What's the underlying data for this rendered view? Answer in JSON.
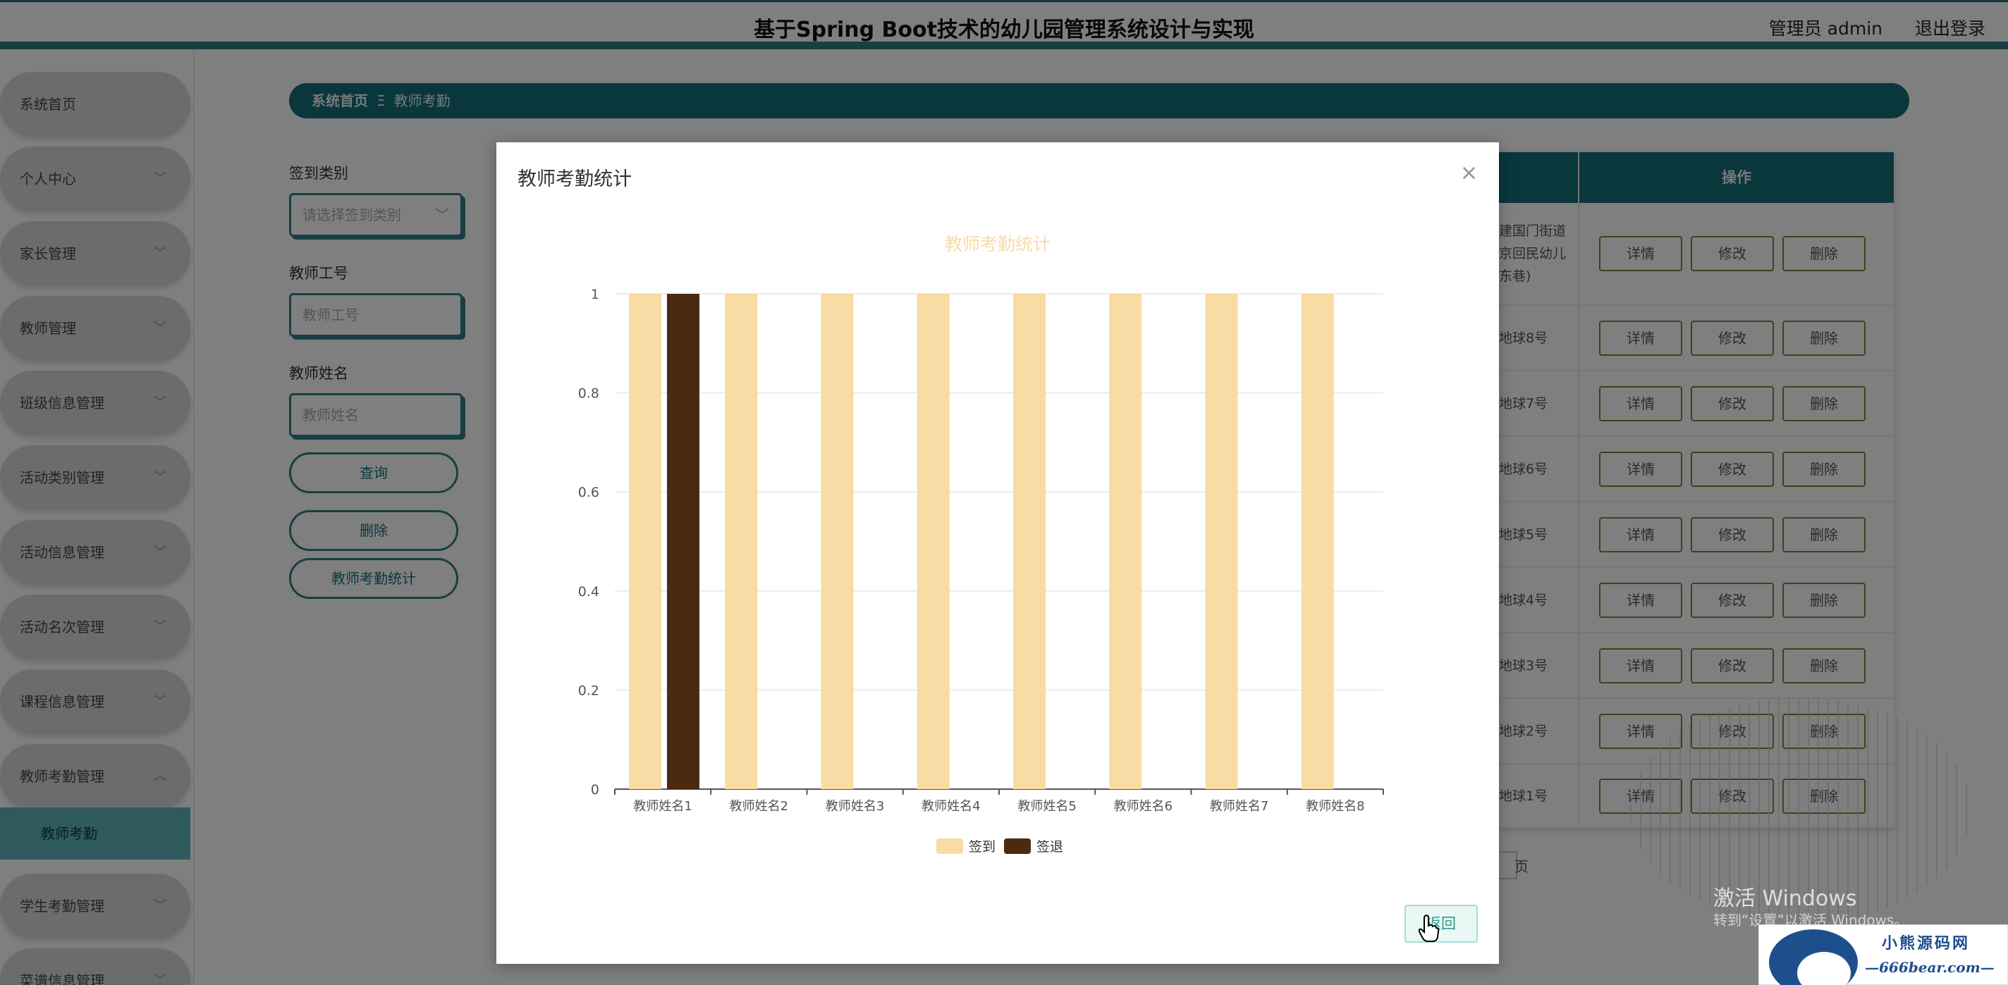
{
  "header": {
    "app_title": "基于Spring Boot技术的幼儿园管理系统设计与实现",
    "admin_label": "管理员 admin",
    "logout_label": "退出登录"
  },
  "sidebar": {
    "items": [
      {
        "label": "系统首页"
      },
      {
        "label": "个人中心"
      },
      {
        "label": "家长管理"
      },
      {
        "label": "教师管理"
      },
      {
        "label": "班级信息管理"
      },
      {
        "label": "活动类别管理"
      },
      {
        "label": "活动信息管理"
      },
      {
        "label": "活动名次管理"
      },
      {
        "label": "课程信息管理"
      },
      {
        "label": "教师考勤管理"
      },
      {
        "label": "学生考勤管理"
      },
      {
        "label": "菜谱信息管理"
      }
    ],
    "active_sub": "教师考勤"
  },
  "breadcrumb": {
    "home": "系统首页",
    "separator": "Ξ",
    "current": "教师考勤"
  },
  "filters": {
    "sign_type_label": "签到类别",
    "sign_type_placeholder": "请选择签到类别",
    "teacher_id_label": "教师工号",
    "teacher_id_placeholder": "教师工号",
    "teacher_name_label": "教师姓名",
    "teacher_name_placeholder": "教师姓名",
    "query_button": "查询",
    "delete_button": "删除",
    "stats_button": "教师考勤统计"
  },
  "table": {
    "op_header": "操作",
    "rows": [
      {
        "addr": "建国门街道 京回民幼儿 东巷)"
      },
      {
        "addr": "地球8号"
      },
      {
        "addr": "地球7号"
      },
      {
        "addr": "地球6号"
      },
      {
        "addr": "地球5号"
      },
      {
        "addr": "地球4号"
      },
      {
        "addr": "地球3号"
      },
      {
        "addr": "地球2号"
      },
      {
        "addr": "地球1号"
      }
    ],
    "btn_detail": "详情",
    "btn_edit": "修改",
    "btn_delete": "删除",
    "pager_unit": "页"
  },
  "watermark": {
    "line1": "激活 Windows",
    "line2": "转到“设置”以激活 Windows。"
  },
  "modal": {
    "title": "教师考勤统计",
    "close": "×",
    "return_button": "返回"
  },
  "chart_data": {
    "type": "bar",
    "title": "教师考勤统计",
    "categories": [
      "教师姓名1",
      "教师姓名2",
      "教师姓名3",
      "教师姓名4",
      "教师姓名5",
      "教师姓名6",
      "教师姓名7",
      "教师姓名8"
    ],
    "series": [
      {
        "name": "签到",
        "values": [
          1,
          1,
          1,
          1,
          1,
          1,
          1,
          1
        ],
        "color": "#f8dca5"
      },
      {
        "name": "签退",
        "values": [
          1,
          0,
          0,
          0,
          0,
          0,
          0,
          0
        ],
        "color": "#4a2b12"
      }
    ],
    "ylim": [
      0,
      1
    ],
    "yticks": [
      "0",
      "0.2",
      "0.4",
      "0.6",
      "0.8",
      "1"
    ],
    "title_color": "#f5dca9",
    "grid": true,
    "legend_position": "bottom"
  },
  "logo": {
    "name": "小熊源码网",
    "domain": "—666bear.com—"
  },
  "colors": {
    "brand_teal": "#136f78",
    "accent_teal": "#2e7f87"
  }
}
